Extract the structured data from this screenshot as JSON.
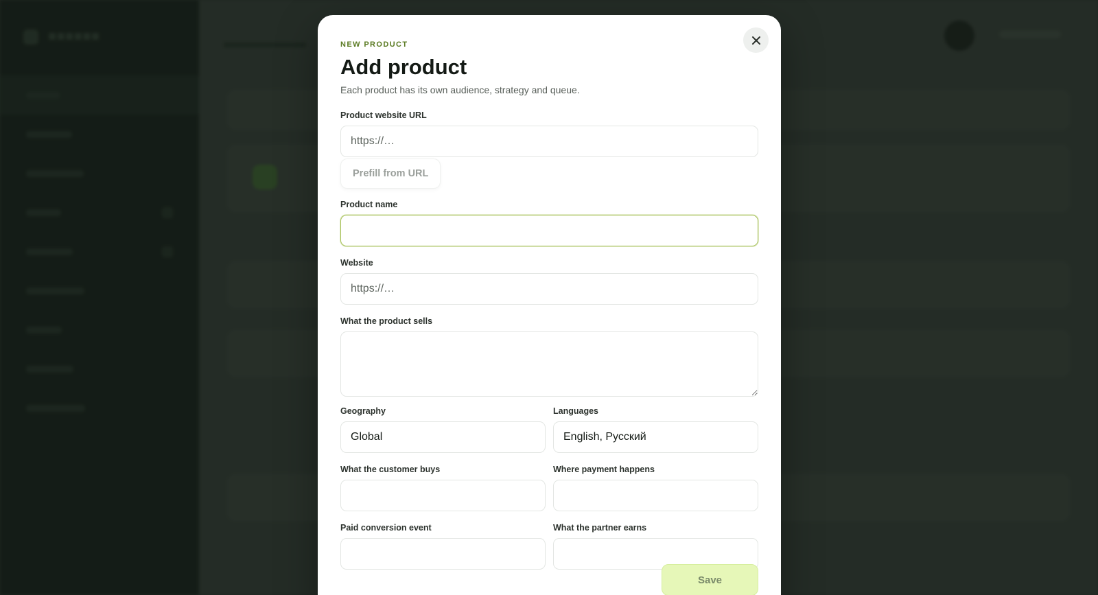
{
  "background": {
    "nav_count": 9
  },
  "modal": {
    "eyebrow": "NEW PRODUCT",
    "title": "Add product",
    "subtitle": "Each product has its own audience, strategy and queue.",
    "close_icon": "close-icon",
    "fields": {
      "product_url": {
        "label": "Product website URL",
        "placeholder": "https://…",
        "value": ""
      },
      "prefill_label": "Prefill from URL",
      "product_name": {
        "label": "Product name",
        "value": ""
      },
      "website": {
        "label": "Website",
        "placeholder": "https://…",
        "value": ""
      },
      "sells": {
        "label": "What the product sells",
        "value": ""
      },
      "geography": {
        "label": "Geography",
        "value": "Global"
      },
      "languages": {
        "label": "Languages",
        "value": "English, Русский"
      },
      "customer_buys": {
        "label": "What the customer buys",
        "value": ""
      },
      "payment": {
        "label": "Where payment happens",
        "value": ""
      },
      "conversion": {
        "label": "Paid conversion event",
        "value": ""
      },
      "partner_earns": {
        "label": "What the partner earns",
        "value": ""
      }
    },
    "save_label": "Save"
  },
  "colors": {
    "accent": "#5a7a22",
    "focus_border": "#a8c25c",
    "save_bg": "#e6f7b8"
  }
}
